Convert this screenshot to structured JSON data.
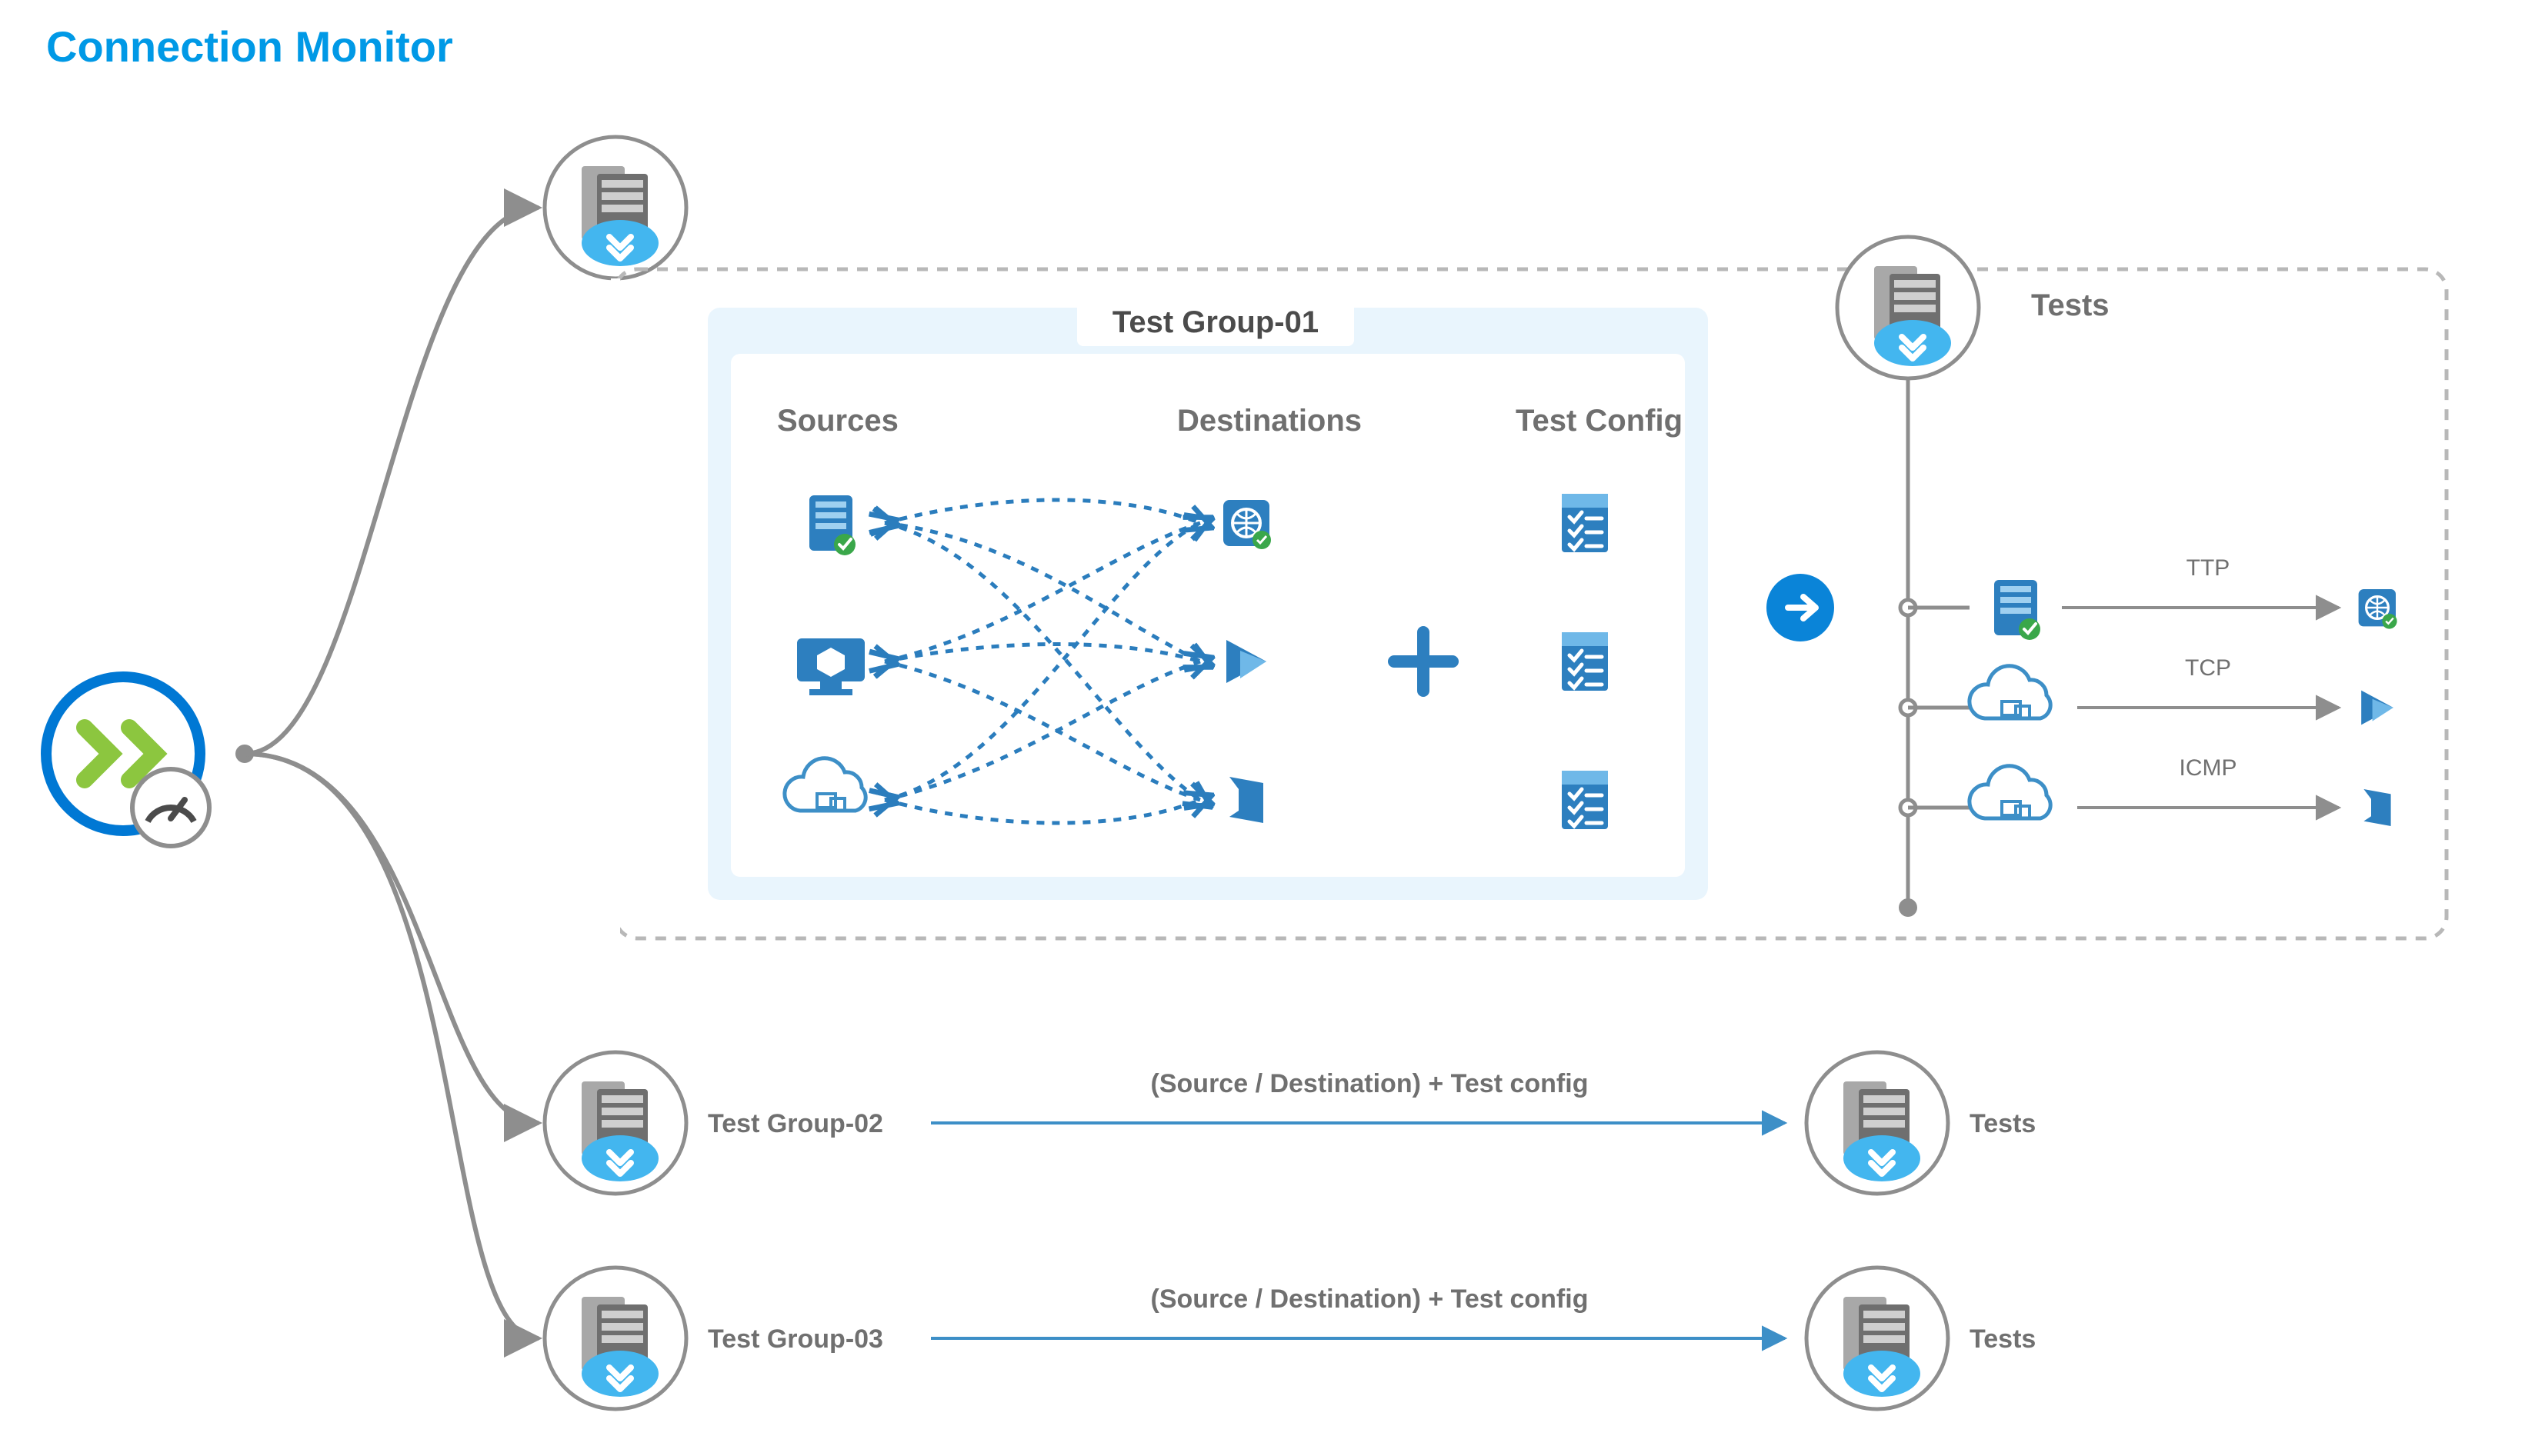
{
  "title": "Connection Monitor",
  "testGroup1": {
    "title": "Test Group-01",
    "sources_label": "Sources",
    "destinations_label": "Destinations",
    "config_label": "Test Config"
  },
  "tests_label": "Tests",
  "protocols": [
    "TTP",
    "TCP",
    "ICMP"
  ],
  "rows": [
    {
      "group": "Test Group-02",
      "note": "(Source / Destination) + Test config",
      "out": "Tests"
    },
    {
      "group": "Test Group-03",
      "note": "(Source / Destination) + Test config",
      "out": "Tests"
    }
  ]
}
